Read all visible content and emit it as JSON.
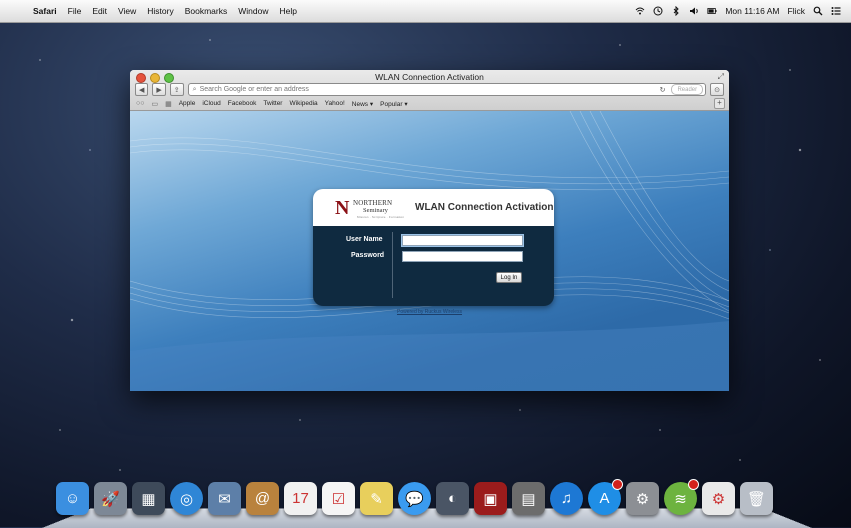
{
  "menubar": {
    "app": "Safari",
    "items": [
      "File",
      "Edit",
      "View",
      "History",
      "Bookmarks",
      "Window",
      "Help"
    ],
    "clock": "Mon 11:16 AM",
    "user": "Flick"
  },
  "window": {
    "title": "WLAN Connection Activation",
    "address_placeholder": "Search Google or enter an address",
    "reader_label": "Reader",
    "bookmarks": [
      "Apple",
      "iCloud",
      "Facebook",
      "Twitter",
      "Wikipedia",
      "Yahoo!",
      "News ▾",
      "Popular ▾"
    ]
  },
  "login": {
    "logo_line1": "NORTHERN",
    "logo_line2": "Seminary",
    "logo_tagline": "Mission · Scripture · Formation",
    "title": "WLAN Connection Activation",
    "username_label": "User Name",
    "password_label": "Password",
    "username_value": "",
    "password_value": "",
    "button_label": "Log In",
    "powered_by": "Powered by Ruckus Wireless"
  },
  "dock": {
    "items": [
      {
        "name": "finder-icon",
        "glyph": "☺",
        "color": "#3b8fe0"
      },
      {
        "name": "launchpad-icon",
        "glyph": "🚀",
        "color": "#7d8896"
      },
      {
        "name": "mission-control-icon",
        "glyph": "▦",
        "color": "#3e4a5a"
      },
      {
        "name": "safari-icon",
        "glyph": "◎",
        "color": "#2f86d6"
      },
      {
        "name": "mail-icon",
        "glyph": "✉",
        "color": "#5d7fa8"
      },
      {
        "name": "contacts-icon",
        "glyph": "@",
        "color": "#b9823d"
      },
      {
        "name": "calendar-icon",
        "glyph": "17",
        "color": "#f1f1f1"
      },
      {
        "name": "reminders-icon",
        "glyph": "☑",
        "color": "#f5f5f5"
      },
      {
        "name": "notes-icon",
        "glyph": "✎",
        "color": "#e8cf5c"
      },
      {
        "name": "messages-icon",
        "glyph": "💬",
        "color": "#3a9bf0"
      },
      {
        "name": "facetime-icon",
        "glyph": "◐",
        "color": "#4a5565"
      },
      {
        "name": "photo-booth-icon",
        "glyph": "▣",
        "color": "#9b1c1c"
      },
      {
        "name": "iphoto-icon",
        "glyph": "▤",
        "color": "#6c6c6c"
      },
      {
        "name": "itunes-icon",
        "glyph": "♫",
        "color": "#1d78d4"
      },
      {
        "name": "app-store-icon",
        "glyph": "A",
        "color": "#1f8ee6",
        "badge": true
      },
      {
        "name": "system-preferences-icon",
        "glyph": "⚙",
        "color": "#8c8f94"
      },
      {
        "name": "spotify-icon",
        "glyph": "≋",
        "color": "#6db33f",
        "badge": true
      },
      {
        "name": "config-file-icon",
        "glyph": "⚙",
        "color": "#e9e9e9"
      },
      {
        "name": "trash-icon",
        "glyph": "🗑",
        "color": "#b8bec7"
      }
    ]
  }
}
